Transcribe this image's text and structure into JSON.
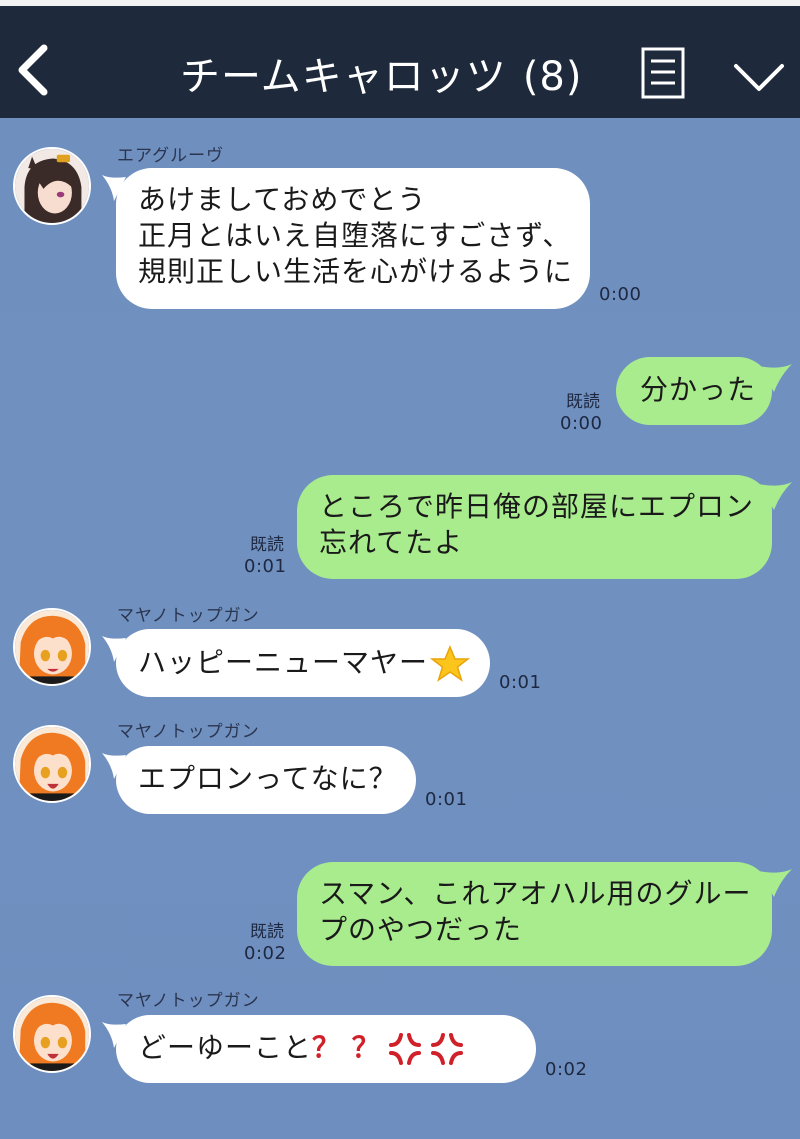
{
  "header": {
    "title": "チームキャロッツ",
    "member_count": "(8)",
    "back_icon": "chevron-left-icon",
    "menu_icon": "list-icon",
    "expand_icon": "chevron-down-icon"
  },
  "colors": {
    "header_bg": "#1e2a3c",
    "chat_bg": "#7090c0",
    "incoming_bubble": "#ffffff",
    "outgoing_bubble": "#a9ec8e"
  },
  "messages": [
    {
      "direction": "incoming",
      "sender": "エアグルーヴ",
      "lines": [
        "あけましておめでとう",
        "正月とはいえ自堕落にすごさず、",
        "規則正しい生活を心がけるように"
      ],
      "time": "0:00"
    },
    {
      "direction": "outgoing",
      "lines": [
        "分かった"
      ],
      "read_label": "既読",
      "time": "0:00"
    },
    {
      "direction": "outgoing",
      "lines": [
        "ところで昨日俺の部屋にエプロン",
        "忘れてたよ"
      ],
      "read_label": "既読",
      "time": "0:01"
    },
    {
      "direction": "incoming",
      "sender": "マヤノトップガン",
      "lines": [
        "ハッピーニューマヤー"
      ],
      "emoji": "star-emoji-icon",
      "time": "0:01"
    },
    {
      "direction": "incoming",
      "sender": "マヤノトップガン",
      "lines": [
        "エプロンってなに？"
      ],
      "time": "0:01"
    },
    {
      "direction": "outgoing",
      "lines": [
        "スマン、これアオハル用のグルー",
        "プのやつだった"
      ],
      "read_label": "既読",
      "time": "0:02"
    },
    {
      "direction": "incoming",
      "sender": "マヤノトップガン",
      "text": "どーゆーこと",
      "marks": "？ ？",
      "emoji": "anger-symbol-icon",
      "time": "0:02"
    }
  ]
}
